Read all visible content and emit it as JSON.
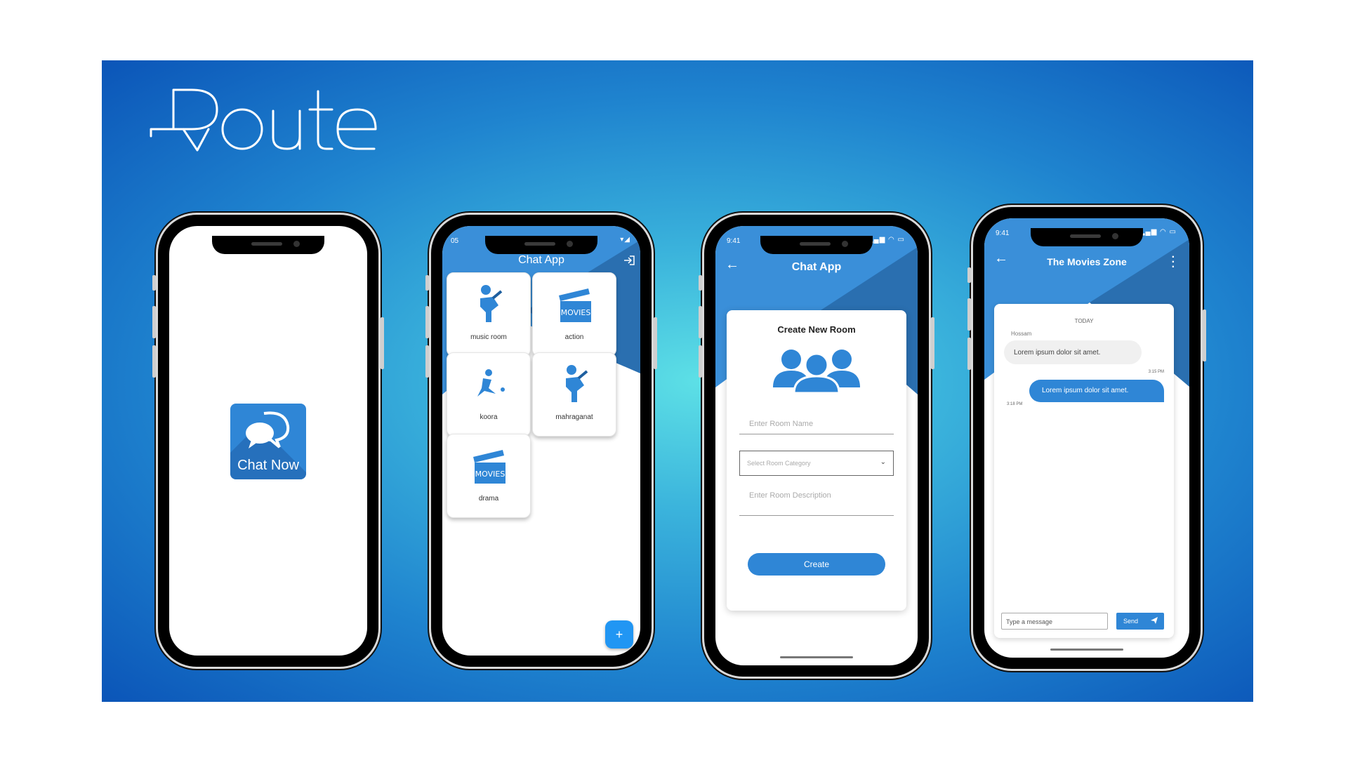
{
  "brand": {
    "logo_text": "Route"
  },
  "phone1": {
    "app_icon_label": "Chat Now"
  },
  "phone2": {
    "status_time": "05",
    "title": "Chat App",
    "rooms": [
      {
        "label": "music room",
        "icon": "microphone-fist-icon"
      },
      {
        "label": "action",
        "icon": "movies-clapper-icon"
      },
      {
        "label": "koora",
        "icon": "football-player-icon"
      },
      {
        "label": "mahraganat",
        "icon": "microphone-fist-icon"
      },
      {
        "label": "drama",
        "icon": "movies-clapper-icon"
      }
    ],
    "fab_label": "+"
  },
  "phone3": {
    "status_time": "9:41",
    "title": "Chat App",
    "form_title": "Create New Room",
    "room_name_placeholder": "Enter  Room Name",
    "category_placeholder": "Select Room Category",
    "description_placeholder": "Enter  Room Description",
    "create_label": "Create"
  },
  "phone4": {
    "status_time": "9:41",
    "title": "The Movies Zone",
    "day_label": "TODAY",
    "sender": "Hossam",
    "incoming_text": "Lorem ipsum dolor sit amet.",
    "incoming_time": "3:15 PM",
    "outgoing_text": "Lorem ipsum dolor sit amet.",
    "outgoing_time": "3:18 PM",
    "input_placeholder": "Type a message",
    "send_label": "Send"
  },
  "colors": {
    "primary": "#2f86d6",
    "header_dark": "#2a6fb0",
    "background_blue": "#1f84cf"
  }
}
